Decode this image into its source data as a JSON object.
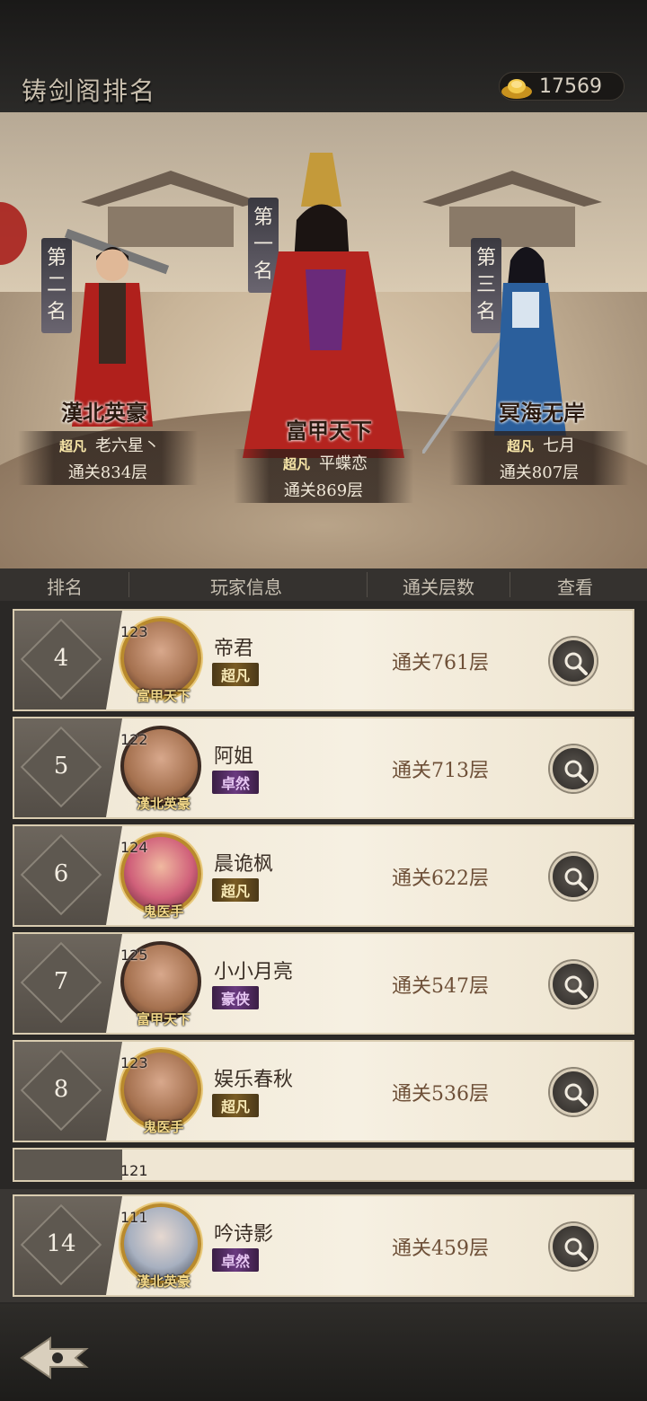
{
  "header": {
    "title": "铸剑阁排名",
    "gold_amount": "17569",
    "gold_icon": "gold-ingot-icon"
  },
  "podium": [
    {
      "rank_label": "第二名",
      "clan": "漢北英豪",
      "tier": "超凡",
      "name": "老六星丶",
      "floor": "通关834层"
    },
    {
      "rank_label": "第一名",
      "clan": "富甲天下",
      "tier": "超凡",
      "name": "平蝶恋",
      "floor": "通关869层"
    },
    {
      "rank_label": "第三名",
      "clan": "冥海无岸",
      "tier": "超凡",
      "name": "七月",
      "floor": "通关807层"
    }
  ],
  "columns": {
    "rank": "排名",
    "player": "玩家信息",
    "floors": "通关层数",
    "view": "查看"
  },
  "rows": [
    {
      "rank": "4",
      "level": "123",
      "clan": "富甲天下",
      "name": "帝君",
      "tier": "超凡",
      "tier_style": "gold",
      "floor": "通关761层"
    },
    {
      "rank": "5",
      "level": "122",
      "clan": "漢北英豪",
      "name": "阿姐",
      "tier": "卓然",
      "tier_style": "purple",
      "floor": "通关713层"
    },
    {
      "rank": "6",
      "level": "124",
      "clan": "鬼医手",
      "name": "晨诡枫",
      "tier": "超凡",
      "tier_style": "gold",
      "floor": "通关622层"
    },
    {
      "rank": "7",
      "level": "125",
      "clan": "富甲天下",
      "name": "小小月亮",
      "tier": "豪侠",
      "tier_style": "purple",
      "floor": "通关547层"
    },
    {
      "rank": "8",
      "level": "123",
      "clan": "鬼医手",
      "name": "娱乐春秋",
      "tier": "超凡",
      "tier_style": "gold",
      "floor": "通关536层"
    }
  ],
  "partial_row": {
    "level": "121"
  },
  "my_row": {
    "rank": "14",
    "level": "111",
    "clan": "漢北英豪",
    "name": "吟诗影",
    "tier": "卓然",
    "tier_style": "purple",
    "floor": "通关459层"
  },
  "icons": {
    "view": "search-icon",
    "back": "back-arrow-icon"
  }
}
